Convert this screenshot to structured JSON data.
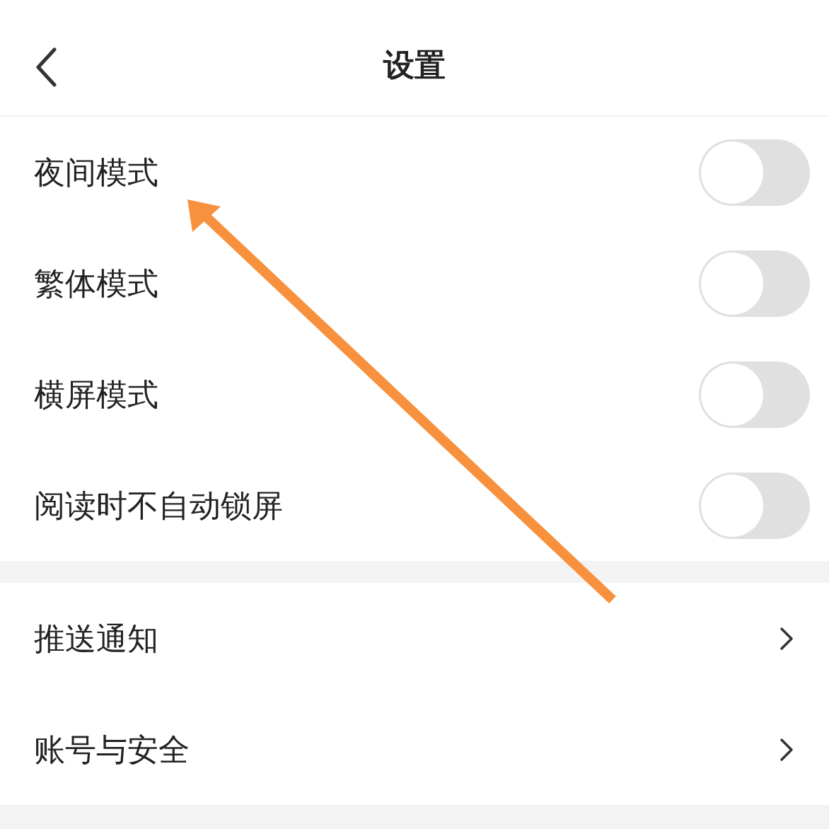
{
  "header": {
    "title": "设置"
  },
  "toggles": [
    {
      "label": "夜间模式",
      "on": false
    },
    {
      "label": "繁体模式",
      "on": false
    },
    {
      "label": "横屏模式",
      "on": false
    },
    {
      "label": "阅读时不自动锁屏",
      "on": false
    }
  ],
  "links": [
    {
      "label": "推送通知"
    },
    {
      "label": "账号与安全"
    }
  ]
}
